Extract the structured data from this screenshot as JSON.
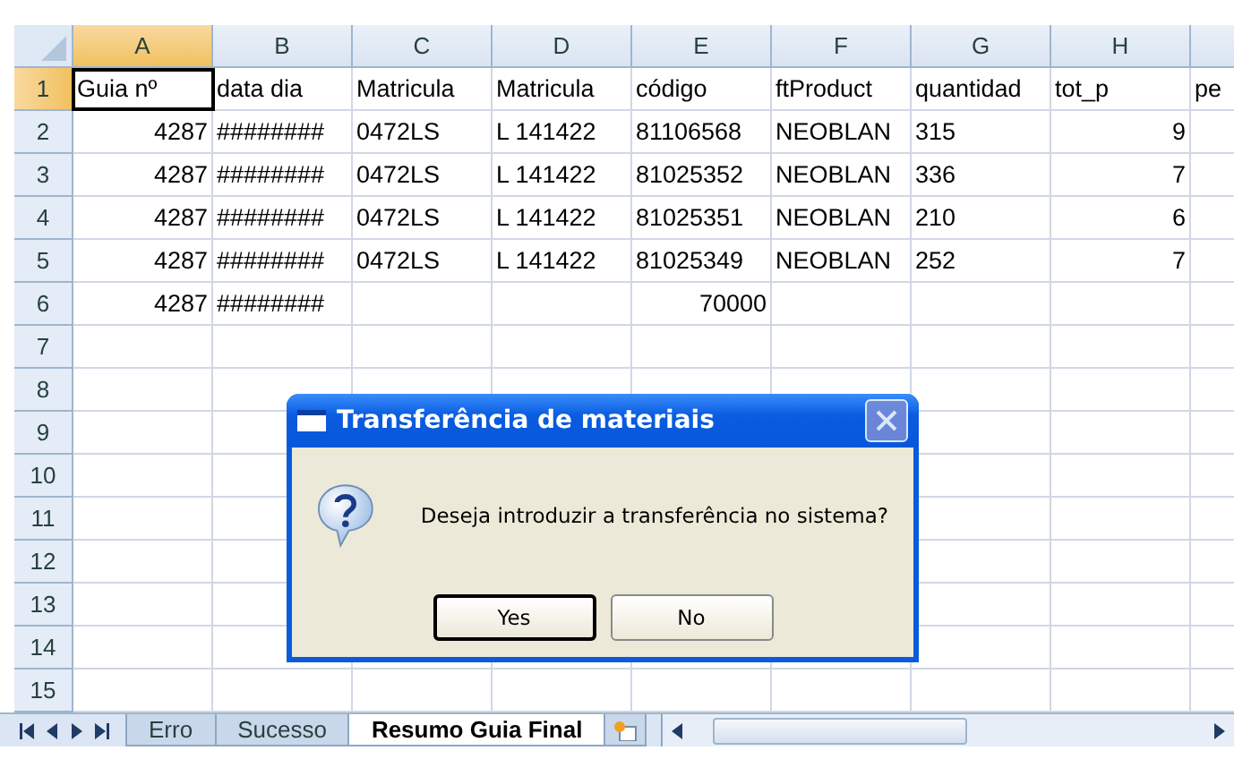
{
  "columns": [
    {
      "label": "A",
      "selected": true
    },
    {
      "label": "B",
      "selected": false
    },
    {
      "label": "C",
      "selected": false
    },
    {
      "label": "D",
      "selected": false
    },
    {
      "label": "E",
      "selected": false
    },
    {
      "label": "F",
      "selected": false
    },
    {
      "label": "G",
      "selected": false
    },
    {
      "label": "H",
      "selected": false
    }
  ],
  "rows": [
    {
      "label": "1",
      "selected": true,
      "cells": [
        {
          "text": "Guia nº",
          "kind": "text",
          "selected": true
        },
        {
          "text": "data dia",
          "kind": "text"
        },
        {
          "text": "Matricula",
          "kind": "text"
        },
        {
          "text": "Matricula",
          "kind": "text"
        },
        {
          "text": "código",
          "kind": "text"
        },
        {
          "text": "ftProduct",
          "kind": "text"
        },
        {
          "text": "quantidad",
          "kind": "text"
        },
        {
          "text": "tot_p",
          "kind": "text"
        },
        {
          "text": "pe",
          "kind": "text"
        }
      ]
    },
    {
      "label": "2",
      "selected": false,
      "cells": [
        {
          "text": "4287",
          "kind": "number"
        },
        {
          "text": "########",
          "kind": "text"
        },
        {
          "text": "0472LS",
          "kind": "text"
        },
        {
          "text": "L 141422",
          "kind": "text"
        },
        {
          "text": "81106568",
          "kind": "text"
        },
        {
          "text": "NEOBLAN",
          "kind": "text"
        },
        {
          "text": "315",
          "kind": "text"
        },
        {
          "text": "9",
          "kind": "number"
        },
        null
      ]
    },
    {
      "label": "3",
      "selected": false,
      "cells": [
        {
          "text": "4287",
          "kind": "number"
        },
        {
          "text": "########",
          "kind": "text"
        },
        {
          "text": "0472LS",
          "kind": "text"
        },
        {
          "text": "L 141422",
          "kind": "text"
        },
        {
          "text": "81025352",
          "kind": "text"
        },
        {
          "text": "NEOBLAN",
          "kind": "text"
        },
        {
          "text": "336",
          "kind": "text"
        },
        {
          "text": "7",
          "kind": "number"
        },
        null
      ]
    },
    {
      "label": "4",
      "selected": false,
      "cells": [
        {
          "text": "4287",
          "kind": "number"
        },
        {
          "text": "########",
          "kind": "text"
        },
        {
          "text": "0472LS",
          "kind": "text"
        },
        {
          "text": "L 141422",
          "kind": "text"
        },
        {
          "text": "81025351",
          "kind": "text"
        },
        {
          "text": "NEOBLAN",
          "kind": "text"
        },
        {
          "text": "210",
          "kind": "text"
        },
        {
          "text": "6",
          "kind": "number"
        },
        null
      ]
    },
    {
      "label": "5",
      "selected": false,
      "cells": [
        {
          "text": "4287",
          "kind": "number"
        },
        {
          "text": "########",
          "kind": "text"
        },
        {
          "text": "0472LS",
          "kind": "text"
        },
        {
          "text": "L 141422",
          "kind": "text"
        },
        {
          "text": "81025349",
          "kind": "text"
        },
        {
          "text": "NEOBLAN",
          "kind": "text"
        },
        {
          "text": "252",
          "kind": "text"
        },
        {
          "text": "7",
          "kind": "number"
        },
        null
      ]
    },
    {
      "label": "6",
      "selected": false,
      "cells": [
        {
          "text": "4287",
          "kind": "number"
        },
        {
          "text": "########",
          "kind": "text"
        },
        null,
        null,
        {
          "text": "70000",
          "kind": "number"
        },
        null,
        null,
        null,
        null
      ]
    },
    {
      "label": "7",
      "selected": false,
      "cells": []
    },
    {
      "label": "8",
      "selected": false,
      "cells": []
    },
    {
      "label": "9",
      "selected": false,
      "cells": []
    },
    {
      "label": "10",
      "selected": false,
      "cells": []
    },
    {
      "label": "11",
      "selected": false,
      "cells": []
    },
    {
      "label": "12",
      "selected": false,
      "cells": []
    },
    {
      "label": "13",
      "selected": false,
      "cells": []
    },
    {
      "label": "14",
      "selected": false,
      "cells": []
    },
    {
      "label": "15",
      "selected": false,
      "cells": []
    }
  ],
  "sheet_tabs": [
    {
      "label": "Erro",
      "selected": false
    },
    {
      "label": "Sucesso",
      "selected": false
    },
    {
      "label": "Resumo Guia Final",
      "selected": true
    }
  ],
  "dialog": {
    "title": "Transferência de materiais",
    "message": "Deseja introduzir a transferência no sistema?",
    "buttons": [
      {
        "label": "Yes",
        "default": true
      },
      {
        "label": "No",
        "default": false
      }
    ]
  }
}
